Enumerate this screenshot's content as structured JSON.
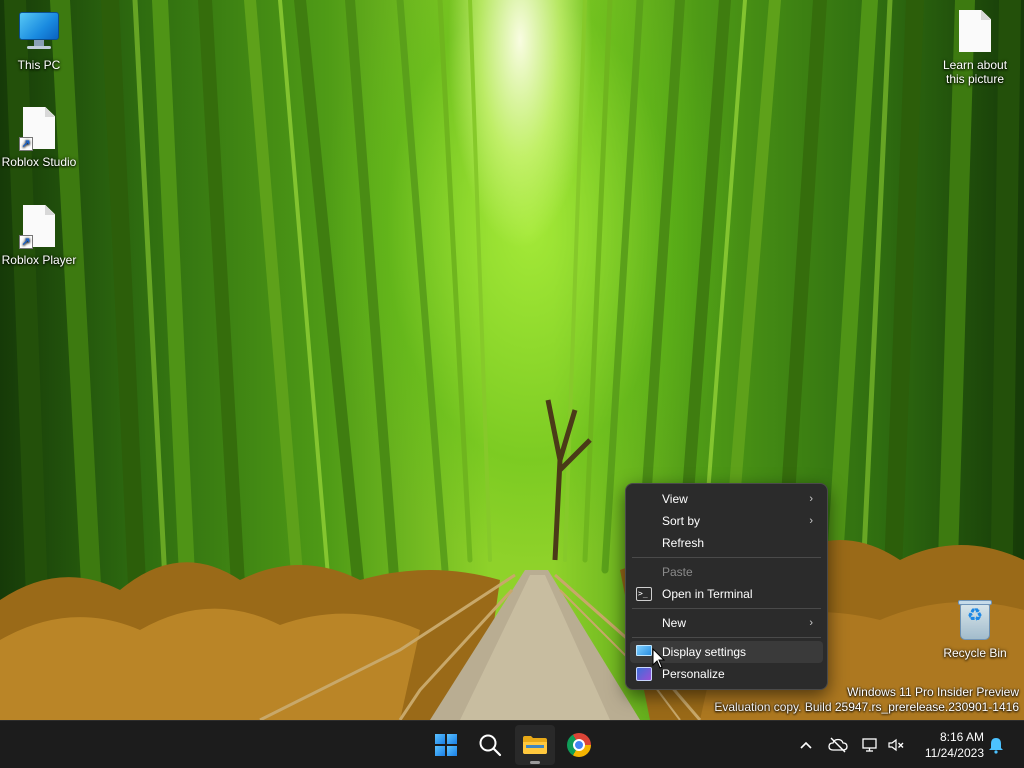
{
  "desktop": {
    "icons": [
      {
        "label": "This PC",
        "icon": "monitor-icon"
      },
      {
        "label": "Roblox Studio",
        "icon": "shortcut-file-icon"
      },
      {
        "label": "Roblox Player",
        "icon": "shortcut-file-icon"
      },
      {
        "label": "Learn about this picture",
        "icon": "file-icon"
      },
      {
        "label": "Recycle Bin",
        "icon": "recycle-bin-icon"
      }
    ],
    "watermark": {
      "line1": "Windows 11 Pro Insider Preview",
      "line2": "Evaluation copy. Build 25947.rs_prerelease.230901-1416"
    }
  },
  "context_menu": {
    "items": [
      {
        "label": "View",
        "submenu": true,
        "enabled": true
      },
      {
        "label": "Sort by",
        "submenu": true,
        "enabled": true
      },
      {
        "label": "Refresh",
        "submenu": false,
        "enabled": true
      },
      {
        "label": "Paste",
        "submenu": false,
        "enabled": false
      },
      {
        "label": "Open in Terminal",
        "submenu": false,
        "enabled": true,
        "icon": "terminal-icon"
      },
      {
        "label": "New",
        "submenu": true,
        "enabled": true
      },
      {
        "label": "Display settings",
        "submenu": false,
        "enabled": true,
        "icon": "display-icon",
        "hovered": true
      },
      {
        "label": "Personalize",
        "submenu": false,
        "enabled": true,
        "icon": "personalize-icon"
      }
    ]
  },
  "taskbar": {
    "pinned": [
      {
        "name": "Start",
        "icon": "windows-logo-icon"
      },
      {
        "name": "Search",
        "icon": "search-icon"
      },
      {
        "name": "File Explorer",
        "icon": "folder-icon",
        "running": true
      },
      {
        "name": "Google Chrome",
        "icon": "chrome-icon"
      }
    ],
    "tray": {
      "icons": [
        "chevron-up-icon",
        "cloud-off-icon",
        "network-icon",
        "volume-muted-icon",
        "notification-bell-icon"
      ],
      "time": "8:16 AM",
      "date": "11/24/2023"
    }
  },
  "colors": {
    "taskbar": "#1c1c1c",
    "menu_bg": "#2b2b2b",
    "menu_hover": "#3a3a3a",
    "accent": "#4cc2ff"
  }
}
